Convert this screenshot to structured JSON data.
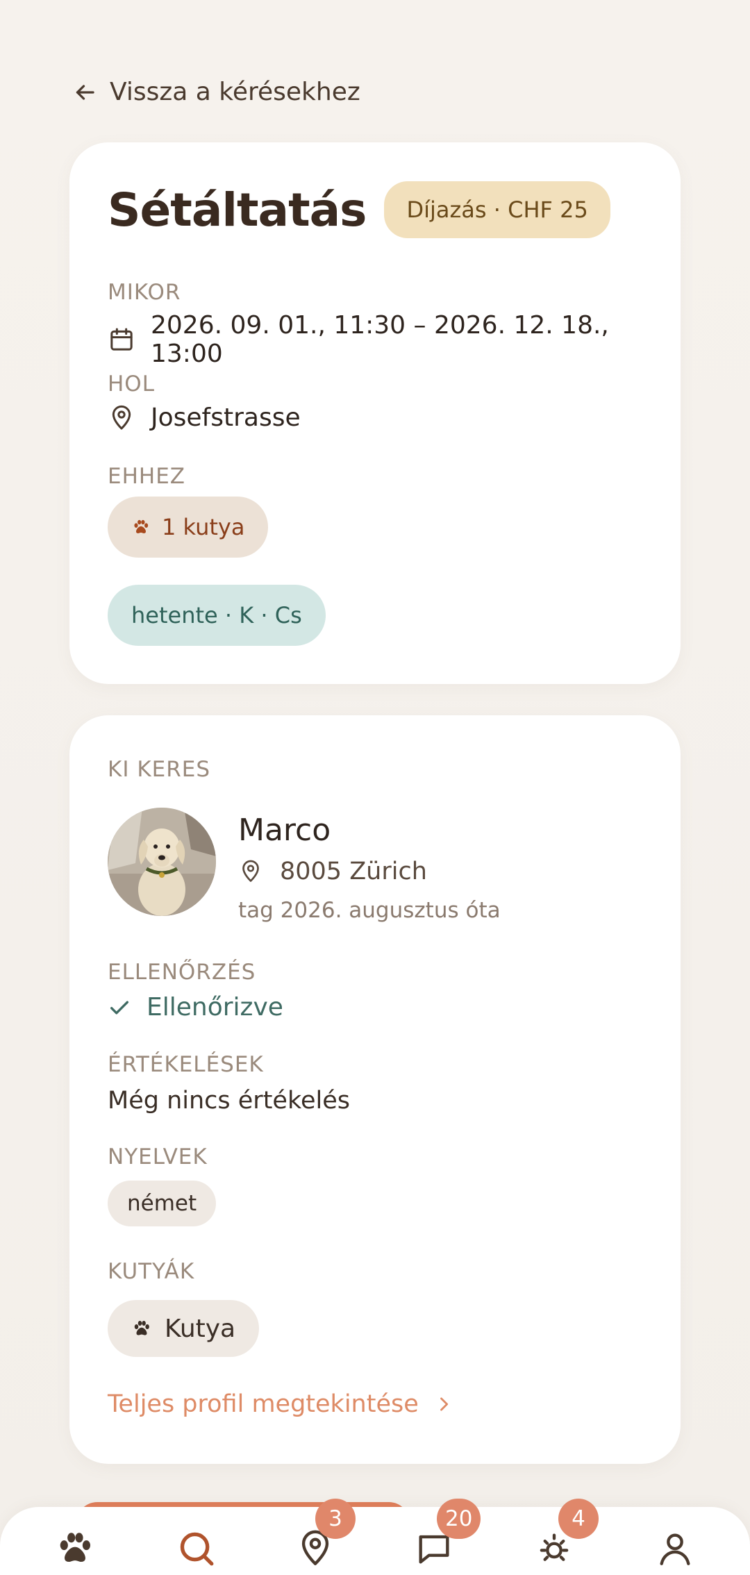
{
  "header": {
    "back_label": "Vissza a kérésekhez"
  },
  "request": {
    "title": "Sétáltatás",
    "price_badge": "Díjazás · CHF 25",
    "when_label": "MIKOR",
    "when_value": "2026. 09. 01., 11:30 – 2026. 12. 18., 13:00",
    "where_label": "HOL",
    "where_value": "Josefstrasse",
    "for_label": "EHHEZ",
    "for_value": "1 kutya",
    "frequency": "hetente · K · Cs"
  },
  "requester": {
    "section_label": "KI KERES",
    "name": "Marco",
    "location": "8005 Zürich",
    "member_since": "tag 2026. augusztus óta",
    "verification_label": "ELLENŐRZÉS",
    "verification_value": "Ellenőrizve",
    "reviews_label": "ÉRTÉKELÉSEK",
    "reviews_value": "Még nincs értékelés",
    "languages_label": "NYELVEK",
    "languages": [
      "német"
    ],
    "dogs_label": "KUTYÁK",
    "dogs": [
      "Kutya"
    ],
    "profile_link": "Teljes profil megtekintése"
  },
  "nav": {
    "items": [
      {
        "icon": "paw-icon",
        "badge": ""
      },
      {
        "icon": "search-icon",
        "badge": ""
      },
      {
        "icon": "map-pin-icon",
        "badge": "3"
      },
      {
        "icon": "chat-icon",
        "badge": "20"
      },
      {
        "icon": "sun-icon",
        "badge": "4"
      },
      {
        "icon": "profile-icon",
        "badge": ""
      }
    ]
  },
  "colors": {
    "accent": "#de8b66",
    "badge": "#e0876a",
    "price_badge_bg": "#f2e0bc",
    "dog_chip_bg": "#ece1d6",
    "freq_chip_bg": "#d3e7e4",
    "verified": "#3f6b63"
  }
}
